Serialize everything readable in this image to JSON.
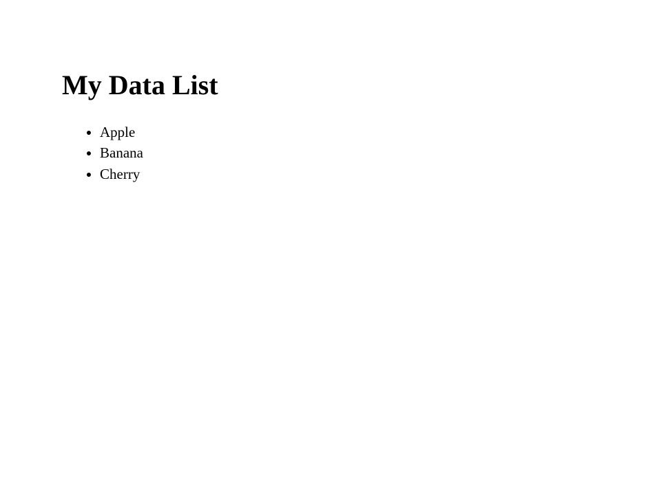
{
  "title": "My Data List",
  "items": [
    "Apple",
    "Banana",
    "Cherry"
  ]
}
